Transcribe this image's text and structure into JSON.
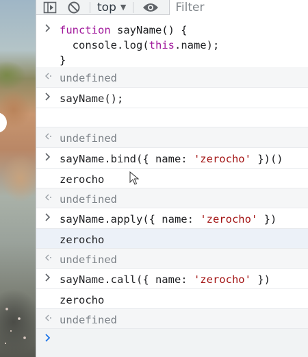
{
  "toolbar": {
    "context_label": "top",
    "filter_placeholder": "Filter"
  },
  "console": {
    "entries": [
      {
        "kind": "input",
        "lines": [
          "function sayName() {",
          "  console.log(this.name);",
          "}"
        ]
      },
      {
        "kind": "result",
        "text": "undefined"
      },
      {
        "kind": "input",
        "text": "sayName();"
      },
      {
        "kind": "empty"
      },
      {
        "kind": "result",
        "text": "undefined"
      },
      {
        "kind": "input",
        "parts": [
          "sayName.bind({ name: ",
          "'zerocho'",
          " })()"
        ]
      },
      {
        "kind": "log",
        "text": "zerocho"
      },
      {
        "kind": "result",
        "text": "undefined"
      },
      {
        "kind": "input",
        "parts": [
          "sayName.apply({ name: ",
          "'zerocho'",
          " })"
        ]
      },
      {
        "kind": "log",
        "text": "zerocho"
      },
      {
        "kind": "result",
        "text": "undefined"
      },
      {
        "kind": "input",
        "parts": [
          "sayName.call({ name: ",
          "'zerocho'",
          " })"
        ]
      },
      {
        "kind": "log",
        "text": "zerocho"
      },
      {
        "kind": "result",
        "text": "undefined"
      }
    ],
    "fn_line1_kw": "function",
    "fn_line1_rest": " sayName() {",
    "fn_line2_pre": "  console.log(",
    "fn_line2_kw": "this",
    "fn_line2_post": ".name);",
    "fn_line3": "}",
    "r1": "undefined",
    "call1": "sayName();",
    "r2": "undefined",
    "bind_pre": "sayName.bind({ name: ",
    "bind_str": "'zerocho'",
    "bind_post": " })()",
    "log1": "zerocho",
    "r3": "undefined",
    "apply_pre": "sayName.apply({ name: ",
    "apply_str": "'zerocho'",
    "apply_post": " })",
    "log2": "zerocho",
    "r4": "undefined",
    "call_pre": "sayName.call({ name: ",
    "call_str": "'zerocho'",
    "call_post": " })",
    "log3": "zerocho",
    "r5": "undefined"
  },
  "colors": {
    "keyword": "#a0189b",
    "string": "#a31515",
    "prompt_chevron": "#1a73e8",
    "highlight_row": "#ecf1f8"
  },
  "icons": [
    "sidebar-toggle-icon",
    "clear-console-icon",
    "dropdown-caret-icon",
    "eye-icon",
    "input-chevron-icon",
    "result-arrow-icon",
    "prompt-chevron-icon",
    "mouse-cursor-icon"
  ]
}
